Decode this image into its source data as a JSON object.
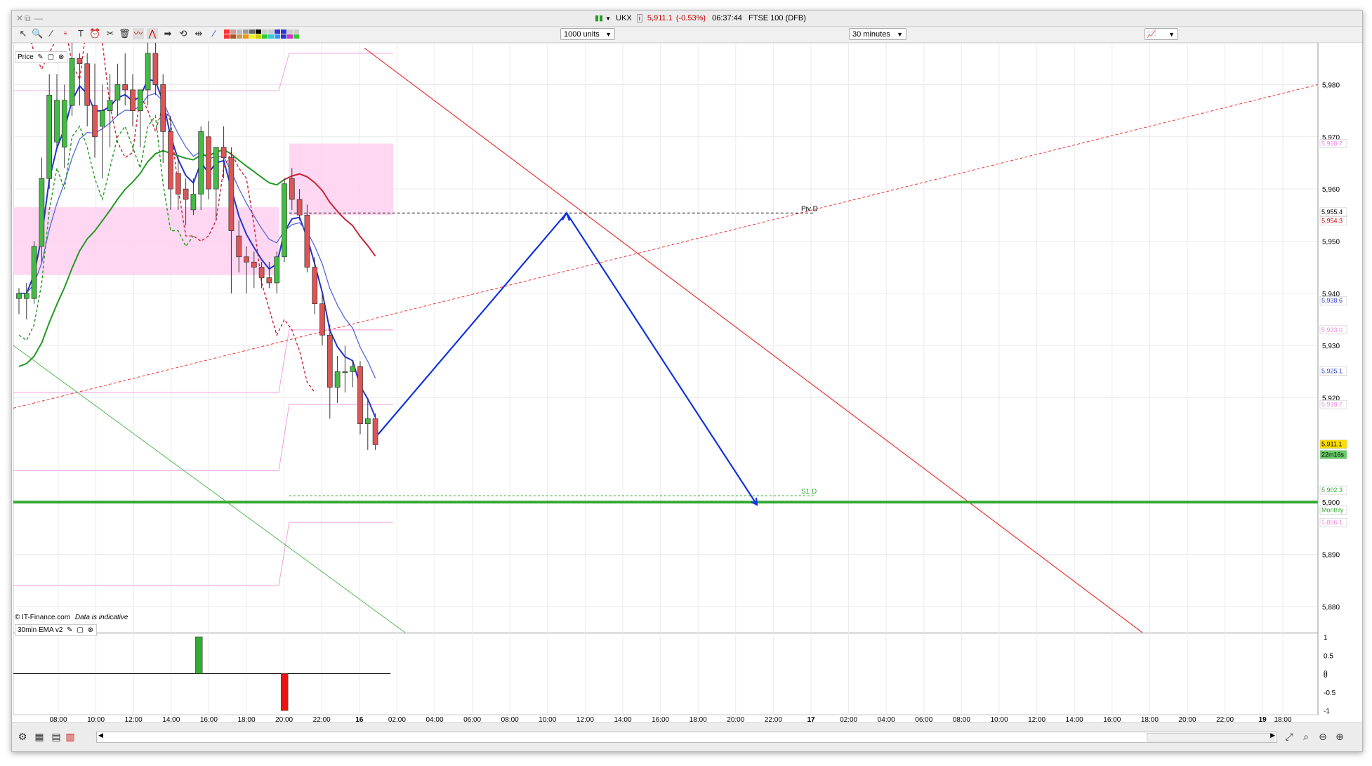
{
  "window": {
    "title": {
      "ticker": "UKX",
      "price": "5,911.1",
      "change": "(-0.53%)",
      "time": "06:37:44",
      "instrument": "FTSE 100 (DFB)"
    }
  },
  "toolbar": {
    "units_select": "1000 units",
    "interval_select": "30 minutes"
  },
  "price_panel": {
    "label": "Price",
    "watermark_source": "© IT-Finance.com",
    "watermark_note": "Data is indicative",
    "pivot_label": "Piv D",
    "s1_label": "S1 D",
    "y_ticks": [
      "5,980",
      "5,970",
      "5,960",
      "5,950",
      "5,940",
      "5,930",
      "5,920",
      "5,900",
      "5,890",
      "5,880"
    ],
    "price_markers": [
      {
        "value": "5,968.7",
        "color": "#ee88dd"
      },
      {
        "value": "5,955.4",
        "color": "#000000"
      },
      {
        "value": "5,954.3",
        "color": "#cc0000"
      },
      {
        "value": "5,938.6",
        "color": "#3344cc"
      },
      {
        "value": "5,933.0",
        "color": "#ee88dd"
      },
      {
        "value": "5,925.1",
        "color": "#3344cc"
      },
      {
        "value": "5,918.7",
        "color": "#ee88dd"
      },
      {
        "value": "5,911.1",
        "color": "#cc9900"
      },
      {
        "value": "22m16s",
        "color": "#33aa33"
      },
      {
        "value": "5,902.3",
        "color": "#33aa33"
      },
      {
        "value": "Monthly",
        "color": "#33aa33"
      },
      {
        "value": "5,896.1",
        "color": "#ee88dd"
      }
    ]
  },
  "indicator_panel": {
    "label": "30min EMA v2",
    "y_ticks": [
      "1",
      "0.5",
      "0",
      "0",
      "-0.5",
      "-1"
    ]
  },
  "x_axis": {
    "ticks": [
      "08:00",
      "10:00",
      "12:00",
      "14:00",
      "16:00",
      "18:00",
      "20:00",
      "22:00",
      "16",
      "02:00",
      "04:00",
      "06:00",
      "08:00",
      "10:00",
      "12:00",
      "14:00",
      "16:00",
      "18:00",
      "20:00",
      "22:00",
      "17",
      "02:00",
      "04:00",
      "06:00",
      "08:00",
      "10:00",
      "12:00",
      "14:00",
      "16:00",
      "18:00",
      "20:00",
      "22:00",
      "19",
      "18:00"
    ]
  },
  "chart_data": {
    "type": "candlestick",
    "instrument": "FTSE 100 (DFB)",
    "interval": "30 minutes",
    "last_price": 5911.1,
    "ylim": [
      5875,
      5988
    ],
    "candles": [
      {
        "o": 5939,
        "h": 5941,
        "l": 5936,
        "c": 5940
      },
      {
        "o": 5939,
        "h": 5942,
        "l": 5935,
        "c": 5940
      },
      {
        "o": 5939,
        "h": 5950,
        "l": 5938,
        "c": 5949
      },
      {
        "o": 5949,
        "h": 5966,
        "l": 5946,
        "c": 5962
      },
      {
        "o": 5962,
        "h": 5982,
        "l": 5960,
        "c": 5978
      },
      {
        "o": 5969,
        "h": 5982,
        "l": 5968,
        "c": 5977
      },
      {
        "o": 5968,
        "h": 5980,
        "l": 5964,
        "c": 5977
      },
      {
        "o": 5976,
        "h": 5988,
        "l": 5974,
        "c": 5985
      },
      {
        "o": 5985,
        "h": 5986,
        "l": 5976,
        "c": 5984
      },
      {
        "o": 5984,
        "h": 5986,
        "l": 5972,
        "c": 5976
      },
      {
        "o": 5976,
        "h": 5984,
        "l": 5966,
        "c": 5970
      },
      {
        "o": 5972,
        "h": 5980,
        "l": 5962,
        "c": 5975
      },
      {
        "o": 5975,
        "h": 5982,
        "l": 5968,
        "c": 5977
      },
      {
        "o": 5977,
        "h": 5984,
        "l": 5974,
        "c": 5980
      },
      {
        "o": 5980,
        "h": 5986,
        "l": 5976,
        "c": 5979
      },
      {
        "o": 5979,
        "h": 5982,
        "l": 5972,
        "c": 5975
      },
      {
        "o": 5975,
        "h": 5978,
        "l": 5968,
        "c": 5979
      },
      {
        "o": 5979,
        "h": 5988,
        "l": 5976,
        "c": 5986
      },
      {
        "o": 5986,
        "h": 5988,
        "l": 5978,
        "c": 5980
      },
      {
        "o": 5980,
        "h": 5982,
        "l": 5965,
        "c": 5971
      },
      {
        "o": 5971,
        "h": 5974,
        "l": 5956,
        "c": 5960
      },
      {
        "o": 5963,
        "h": 5966,
        "l": 5956,
        "c": 5959
      },
      {
        "o": 5960,
        "h": 5962,
        "l": 5953,
        "c": 5958
      },
      {
        "o": 5956,
        "h": 5962,
        "l": 5955,
        "c": 5959
      },
      {
        "o": 5959,
        "h": 5972,
        "l": 5956,
        "c": 5971
      },
      {
        "o": 5970,
        "h": 5973,
        "l": 5958,
        "c": 5960
      },
      {
        "o": 5960,
        "h": 5968,
        "l": 5954,
        "c": 5968
      },
      {
        "o": 5968,
        "h": 5972,
        "l": 5962,
        "c": 5966
      },
      {
        "o": 5966,
        "h": 5968,
        "l": 5940,
        "c": 5952
      },
      {
        "o": 5951,
        "h": 5954,
        "l": 5944,
        "c": 5947
      },
      {
        "o": 5947,
        "h": 5949,
        "l": 5940,
        "c": 5946
      },
      {
        "o": 5946,
        "h": 5948,
        "l": 5941,
        "c": 5945
      },
      {
        "o": 5945,
        "h": 5946,
        "l": 5941,
        "c": 5943
      },
      {
        "o": 5943,
        "h": 5946,
        "l": 5941,
        "c": 5942
      },
      {
        "o": 5942,
        "h": 5948,
        "l": 5940,
        "c": 5947
      },
      {
        "o": 5947,
        "h": 5962,
        "l": 5946,
        "c": 5961
      },
      {
        "o": 5962,
        "h": 5964,
        "l": 5956,
        "c": 5958
      },
      {
        "o": 5958,
        "h": 5960,
        "l": 5954,
        "c": 5955
      },
      {
        "o": 5955,
        "h": 5957,
        "l": 5944,
        "c": 5945
      },
      {
        "o": 5945,
        "h": 5947,
        "l": 5936,
        "c": 5938
      },
      {
        "o": 5938,
        "h": 5940,
        "l": 5930,
        "c": 5932
      },
      {
        "o": 5932,
        "h": 5934,
        "l": 5916,
        "c": 5922
      },
      {
        "o": 5922,
        "h": 5928,
        "l": 5919,
        "c": 5925
      },
      {
        "o": 5925,
        "h": 5930,
        "l": 5921,
        "c": 5925
      },
      {
        "o": 5925,
        "h": 5927,
        "l": 5922,
        "c": 5926
      },
      {
        "o": 5926,
        "h": 5927,
        "l": 5913,
        "c": 5915
      },
      {
        "o": 5915,
        "h": 5920,
        "l": 5910,
        "c": 5916
      },
      {
        "o": 5916,
        "h": 5917,
        "l": 5910,
        "c": 5911
      }
    ],
    "levels": {
      "pivot_daily": 5955.4,
      "s1_daily": 5902.3,
      "monthly": 5900.0
    },
    "indicator": {
      "name": "30min EMA v2",
      "ylim": [
        -1,
        1
      ],
      "signals": [
        {
          "candle": 24,
          "value": 1
        },
        {
          "candle": 34,
          "value": -1
        }
      ]
    },
    "colors": {
      "up_candle": "#44bb44",
      "down_candle": "#dd5555",
      "pivot_zone": "#ffd0f0",
      "ema_fast": "#2233cc",
      "ema_slow": "#5566dd",
      "ma_green": "#229922",
      "ma_red": "#cc2233",
      "projection": "#1133dd",
      "trend_red": "#ee3333",
      "trend_green": "#55bb55",
      "monthly_line": "#33aa33"
    }
  }
}
